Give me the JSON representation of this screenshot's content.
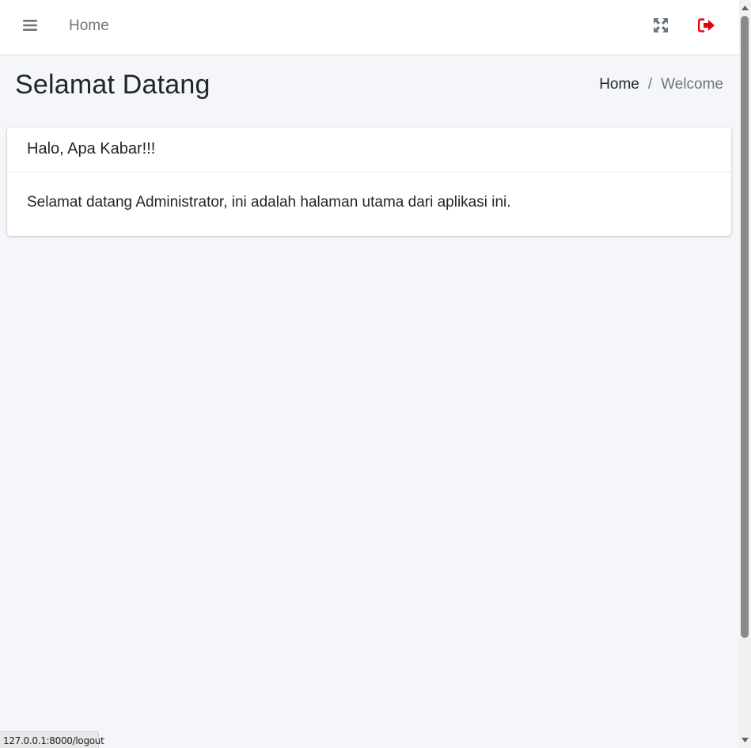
{
  "navbar": {
    "home_label": "Home",
    "icons": {
      "menu": "hamburger-menu-icon",
      "fullscreen": "expand-arrows-icon",
      "logout": "sign-out-icon"
    },
    "colors": {
      "logout": "#e0040b",
      "icon": "#6c757d"
    }
  },
  "content_header": {
    "title": "Selamat Datang",
    "breadcrumb": {
      "home": "Home",
      "separator": "/",
      "active": "Welcome"
    }
  },
  "card": {
    "title": "Halo, Apa Kabar!!!",
    "body": "Selamat datang Administrator, ini adalah halaman utama dari aplikasi ini."
  },
  "status_bar": {
    "url": "127.0.0.1:8000/logout"
  },
  "colors": {
    "page_background": "#f4f6f9",
    "card_background": "#ffffff",
    "text": "#212529",
    "muted": "#6c757d"
  }
}
